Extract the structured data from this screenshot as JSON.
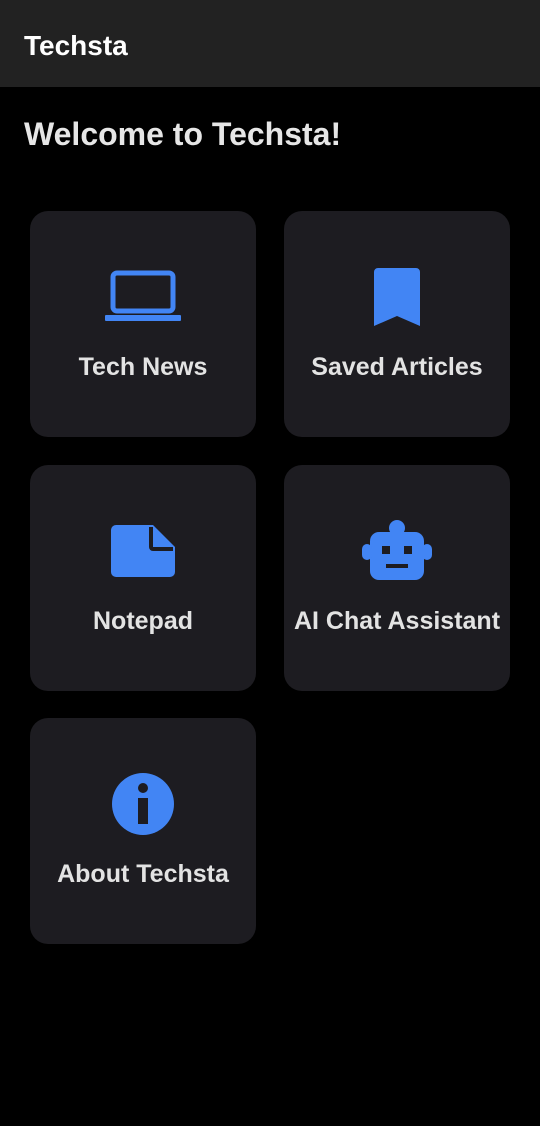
{
  "app_bar": {
    "title": "Techsta"
  },
  "welcome_text": "Welcome to Techsta!",
  "accent_color": "#4285f4",
  "tiles": [
    {
      "label": "Tech News",
      "icon": "laptop-icon"
    },
    {
      "label": "Saved Articles",
      "icon": "bookmark-icon"
    },
    {
      "label": "Notepad",
      "icon": "note-icon"
    },
    {
      "label": "AI Chat Assistant",
      "icon": "robot-icon"
    },
    {
      "label": "About Techsta",
      "icon": "info-icon"
    }
  ]
}
